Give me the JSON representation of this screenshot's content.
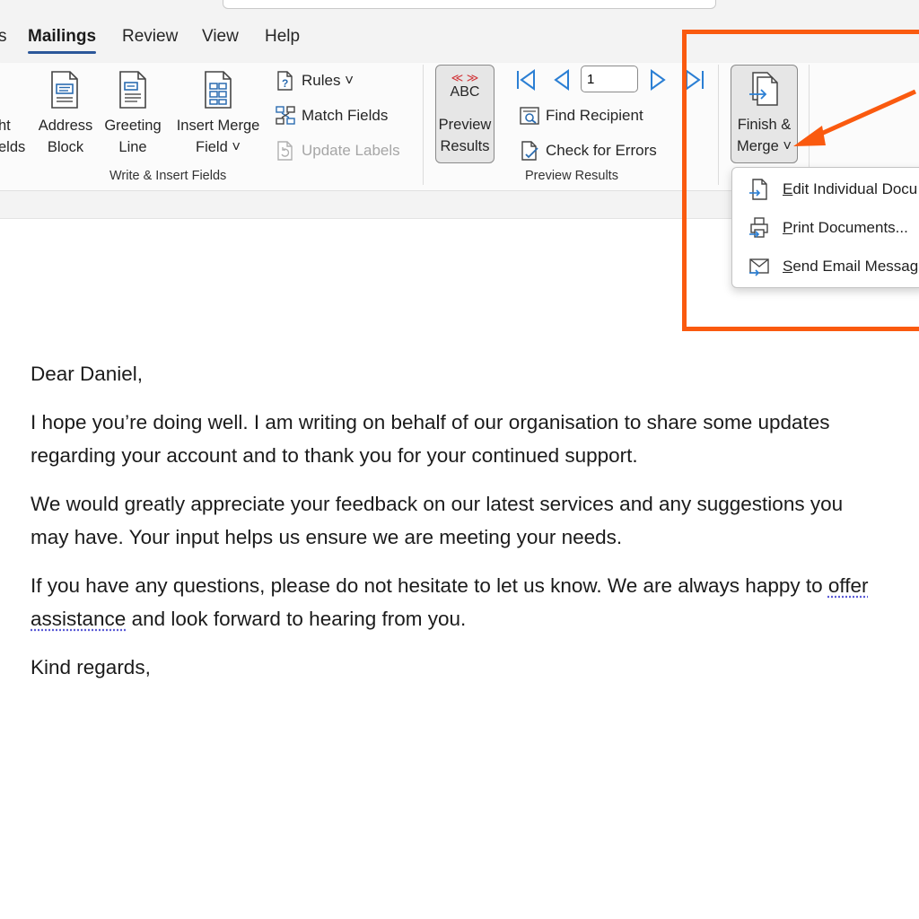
{
  "tabs": {
    "partial": "s",
    "items": [
      "Mailings",
      "Review",
      "View",
      "Help"
    ],
    "active": "Mailings"
  },
  "ribbon": {
    "write_insert": {
      "highlight_fields_partial": [
        "ht",
        "elds"
      ],
      "address_block": [
        "Address",
        "Block"
      ],
      "greeting_line": [
        "Greeting",
        "Line"
      ],
      "insert_merge_field": [
        "Insert Merge",
        "Field ˅"
      ],
      "rules": "Rules ˅",
      "match_fields": "Match Fields",
      "update_labels": "Update Labels",
      "group_label": "Write & Insert Fields"
    },
    "preview": {
      "abc_icon_text": "ABC",
      "preview_results": [
        "Preview",
        "Results"
      ],
      "record_value": "1",
      "find_recipient": "Find Recipient",
      "check_errors": "Check for Errors",
      "group_label": "Preview Results"
    },
    "finish": {
      "finish_merge": [
        "Finish &",
        "Merge ˅"
      ]
    }
  },
  "dropdown": {
    "items": [
      {
        "accel": "E",
        "rest": "dit Individual Docu"
      },
      {
        "accel": "P",
        "rest": "rint Documents..."
      },
      {
        "accel": "S",
        "rest": "end Email Messag"
      }
    ]
  },
  "annotation": {
    "color": "#fa5a0f"
  },
  "document": {
    "greeting": "Dear Daniel,",
    "p1": "I hope you’re doing well. I am writing on behalf of our organisation to share some updates regarding your account and to thank you for your continued support.",
    "p2": "We would greatly appreciate your feedback on our latest services and any suggestions you may have. Your input helps us ensure we are meeting your needs.",
    "p3_before": "If you have any questions, please do not hesitate to let us know. We are always happy to ",
    "p3_flagged": "offer assistance",
    "p3_after": " and look forward to hearing from you.",
    "closing": "Kind regards,"
  }
}
